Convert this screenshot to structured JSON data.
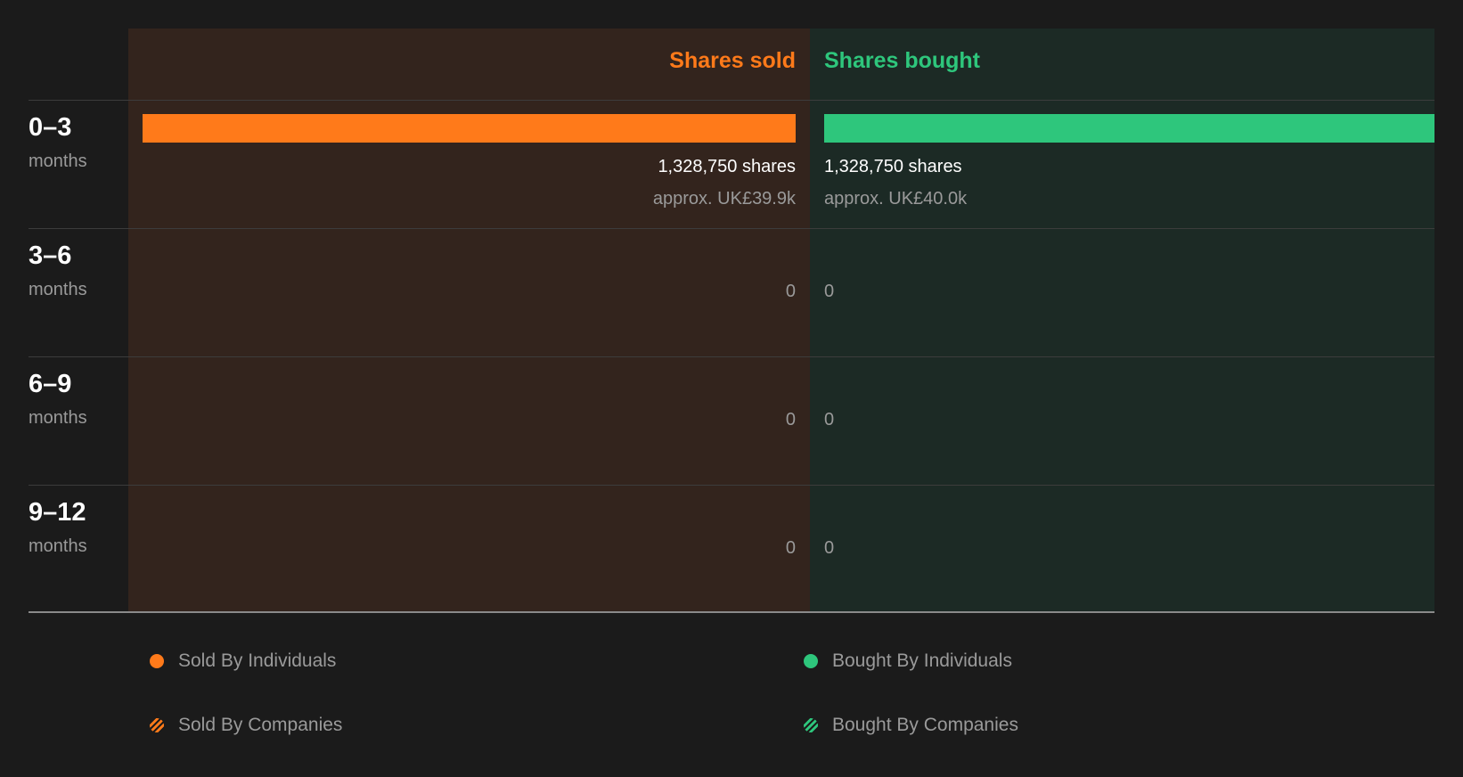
{
  "colors": {
    "sold": "#ff7a1a",
    "bought": "#2ec67c"
  },
  "chart_data": {
    "type": "bar",
    "headers": {
      "sold": "Shares sold",
      "bought": "Shares bought"
    },
    "rows": [
      {
        "range": "0–3",
        "unit": "months",
        "sold_value": 1328750,
        "bought_value": 1328750,
        "sold_label": "1,328,750 shares",
        "bought_label": "1,328,750 shares",
        "sold_approx": "approx. UK£39.9k",
        "bought_approx": "approx. UK£40.0k"
      },
      {
        "range": "3–6",
        "unit": "months",
        "sold_value": 0,
        "bought_value": 0,
        "sold_label": "0",
        "bought_label": "0"
      },
      {
        "range": "6–9",
        "unit": "months",
        "sold_value": 0,
        "bought_value": 0,
        "sold_label": "0",
        "bought_label": "0"
      },
      {
        "range": "9–12",
        "unit": "months",
        "sold_value": 0,
        "bought_value": 0,
        "sold_label": "0",
        "bought_label": "0"
      }
    ],
    "legend": [
      {
        "label": "Sold By Individuals",
        "style": "solid",
        "color": "#ff7a1a"
      },
      {
        "label": "Bought By Individuals",
        "style": "solid",
        "color": "#2ec67c"
      },
      {
        "label": "Sold By Companies",
        "style": "hatched",
        "color": "#ff7a1a"
      },
      {
        "label": "Bought By Companies",
        "style": "hatched",
        "color": "#2ec67c"
      }
    ]
  }
}
